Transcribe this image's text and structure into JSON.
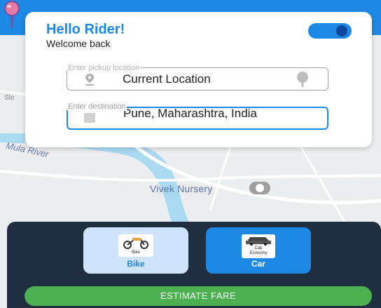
{
  "map": {
    "river_label": "Mula River",
    "edge_label": "Sle",
    "poi_label": "Vivek Nursery"
  },
  "greeting": {
    "title": "Hello Rider!",
    "subtitle": "Welcome back"
  },
  "toggle": {
    "state": "on"
  },
  "pickup": {
    "label": "Enter pickup location",
    "value": "Current Location"
  },
  "destination": {
    "label": "Enter destination",
    "value": "Pune, Maharashtra, India"
  },
  "ride_options": [
    {
      "image_text": "Bike",
      "label": "Bike"
    },
    {
      "image_text_line1": "Cab",
      "image_text_line2": "Economy",
      "label": "Car"
    }
  ],
  "estimate_button": "ESTIMATE FARE",
  "colors": {
    "primary": "#1e88e5",
    "panel": "#1f2f40",
    "button": "#4caf50",
    "bike_card": "#cfe4fb"
  }
}
